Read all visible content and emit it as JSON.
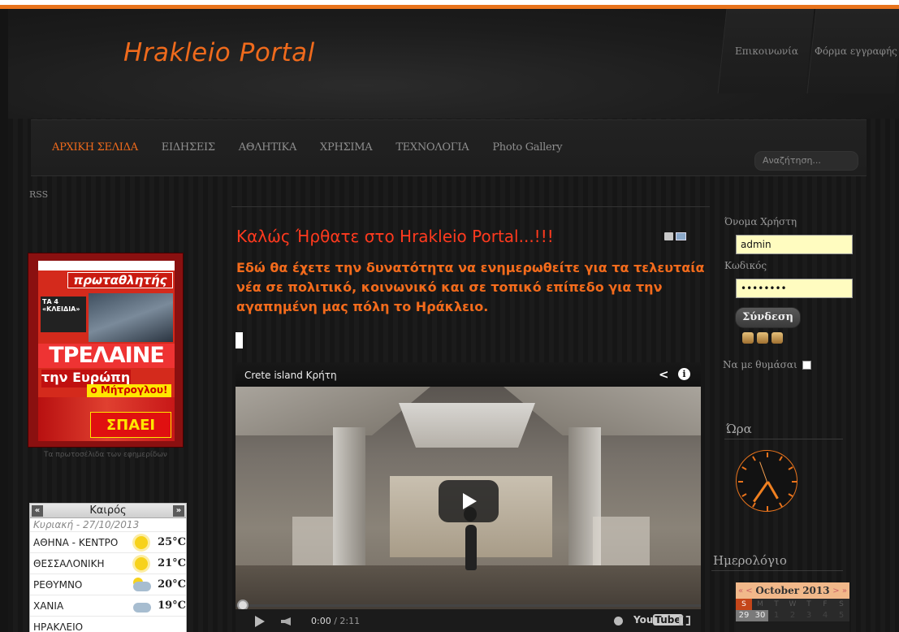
{
  "header": {
    "logo": "Hrakleio Portal",
    "top_links": [
      "Επικοινωνία",
      "Φόρμα εγγραφής"
    ]
  },
  "nav": {
    "items": [
      "ΑΡΧΙΚΗ ΣΕΛΙΔΑ",
      "ΕΙΔΗΣΕΙΣ",
      "ΑΘΛΗΤΙΚΑ",
      "ΧΡΗΣΙΜΑ",
      "ΤΕΧΝΟΛΟΓΙΑ",
      "Photo Gallery"
    ],
    "active_index": 0,
    "search_placeholder": "Αναζήτηση..."
  },
  "rss": "RSS",
  "newspaper": {
    "caption": "Τα πρωτοσέλιδα των εφημερίδων",
    "title": "πρωταθλητής",
    "headline_big": "ΤΡΕΛΑΙΝΕ",
    "headline_mid": "την Ευρώπη",
    "headline_small": "ο Μήτρογλου!",
    "headline_bottom": "ΣΠΑΕΙ",
    "block_text": "ΤΑ 4 «ΚΛΕΙΔΙΑ»"
  },
  "weather": {
    "title": "Καιρός",
    "prev": "«",
    "next": "»",
    "date": "Κυριακή - 27/10/2013",
    "rows": [
      {
        "city": "ΑΘΗΝΑ - ΚΕΝΤΡΟ",
        "temp": "25°C",
        "icon": "sun-icon"
      },
      {
        "city": "ΘΕΣΣΑΛΟΝΙΚΗ",
        "temp": "21°C",
        "icon": "sun-icon"
      },
      {
        "city": "ΡΕΘΥΜΝΟ",
        "temp": "20°C",
        "icon": "partly-cloudy-icon"
      },
      {
        "city": "ΧΑΝΙΑ",
        "temp": "19°C",
        "icon": "cloud-icon"
      },
      {
        "city": "ΗΡΑΚΛΕΙΟ",
        "temp": "",
        "icon": ""
      }
    ]
  },
  "article": {
    "title": "Καλώς Ήρθατε στο Hrakleio Portal...!!!",
    "body": "Εδώ θα έχετε την δυνατότητα να ενημερωθείτε για τα τελευταία νέα σε πολιτικό, κοινωνικό και σε τοπικό επίπεδο για την αγαπημένη μας πόλη το Ηράκλειο."
  },
  "video": {
    "title": "Crete island Κρήτη",
    "time_current": "0:00",
    "time_sep": " / ",
    "time_total": "2:11",
    "brand": "You",
    "brand_tube": "Tube",
    "progress": 0
  },
  "login": {
    "username_label": "Όνομα Χρήστη",
    "username_value": "admin",
    "password_label": "Κωδικός",
    "password_value": "••••••••",
    "submit_label": "Σύνδεση",
    "remember_label": "Να με θυμάσαι"
  },
  "clock": {
    "heading": "Ώρα"
  },
  "calendar": {
    "heading": "Ημερολόγιο",
    "month": "October 2013",
    "prev": "«  <",
    "next": ">  »",
    "days": [
      "S",
      "M",
      "T",
      "W",
      "T",
      "F",
      "S"
    ],
    "dates": [
      "29",
      "30",
      "1",
      "2",
      "3",
      "4",
      "5"
    ]
  },
  "colors": {
    "accent": "#ef6a1c",
    "title_red": "#ff3a1e",
    "input_yellow": "#fffcc0"
  }
}
